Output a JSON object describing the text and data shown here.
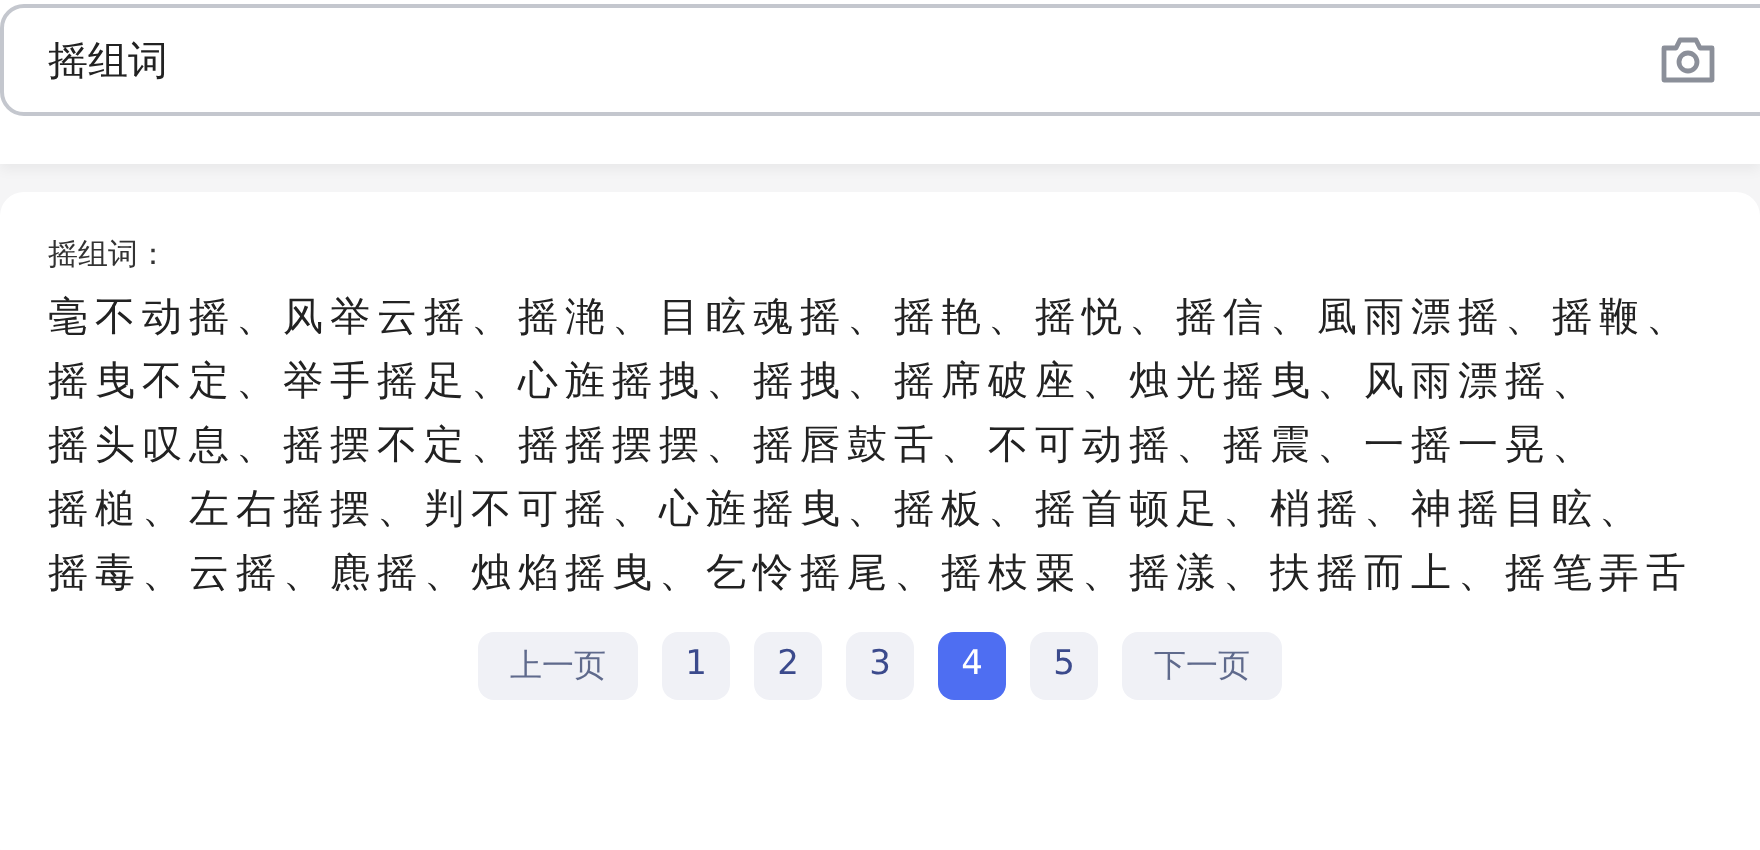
{
  "search": {
    "value": "摇组词"
  },
  "result": {
    "heading": "摇组词：",
    "lines": [
      "毫不动摇、风举云摇、摇滟、目眩魂摇、摇艳、摇悦、摇信、風雨漂摇、摇鞭、",
      "摇曳不定、举手摇足、心旌摇拽、摇拽、摇席破座、烛光摇曳、风雨漂摇、",
      "摇头叹息、摇摆不定、摇摇摆摆、摇唇鼓舌、不可动摇、摇震、一摇一晃、",
      "摇槌、左右摇摆、判不可摇、心旌摇曳、摇板、摇首顿足、梢摇、神摇目眩、",
      "摇毒、云摇、麃摇、烛焰摇曳、乞怜摇尾、摇枝粟、摇漾、扶摇而上、摇笔弄舌"
    ]
  },
  "pagination": [
    {
      "label": "上一页",
      "kind": "prev",
      "selected": false
    },
    {
      "label": "1",
      "kind": "page",
      "selected": false
    },
    {
      "label": "2",
      "kind": "page",
      "selected": false
    },
    {
      "label": "3",
      "kind": "page",
      "selected": false
    },
    {
      "label": "4",
      "kind": "page",
      "selected": true
    },
    {
      "label": "5",
      "kind": "page",
      "selected": false
    },
    {
      "label": "下一页",
      "kind": "next",
      "selected": false
    }
  ]
}
